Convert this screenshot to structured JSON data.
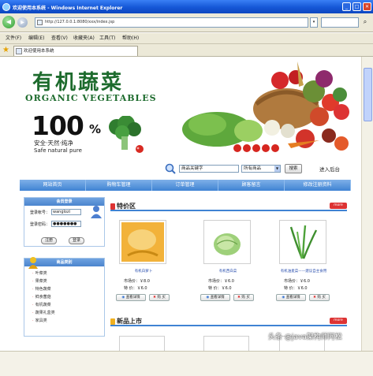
{
  "browser": {
    "title": "欢迎使用本系统 - Windows Internet Explorer",
    "address": "http://127.0.0.1:8080/xxx/index.jsp",
    "menus": [
      "文件(F)",
      "编辑(E)",
      "查看(V)",
      "收藏夹(A)",
      "工具(T)",
      "帮助(H)"
    ],
    "tab": "欢迎使用本系统"
  },
  "banner": {
    "logo_cn": "有机蔬菜",
    "logo_en": "ORGANIC VEGETABLES",
    "badge_num": "100",
    "badge_pct": "%",
    "slogan_cn": "安全·天然·纯净",
    "slogan_en": "Safe natural pure"
  },
  "search": {
    "keyword": "商品关键字",
    "category": "所有商品",
    "button": "搜索",
    "admin": "进入后台"
  },
  "nav": [
    "网站首页",
    "购物车管理",
    "订单管理",
    "顾客留言",
    "修改注册资料"
  ],
  "login": {
    "title": "会员登录",
    "user_label": "登录帐号：",
    "user_value": "wanglozi",
    "pass_label": "登录密码：",
    "pass_value": "●●●●●●●",
    "register": "注册",
    "submit": "登录"
  },
  "categories": {
    "title": "商品类别",
    "items": [
      "叶菜类",
      "果菜类",
      "特色蔬菜",
      "鲜食菌菇",
      "有机蔬菜",
      "蔬果礼盒类",
      "家具类"
    ]
  },
  "specials": {
    "title": "特价区",
    "more": "more",
    "products": [
      {
        "name": "有机白萝卜",
        "market": "市场价：￥8.0",
        "member": "特  价：￥6.0"
      },
      {
        "name": "有机西白菜",
        "market": "市场价：￥6.0",
        "member": "特  价：￥6.0"
      },
      {
        "name": "有机油麦菜——建议自主食用",
        "market": "市场价：￥6.0",
        "member": "特  价：￥6.0"
      }
    ],
    "btn_detail": "查看详情",
    "btn_buy": "购 买"
  },
  "new_arrivals": {
    "title": "新品上市",
    "more": "more"
  },
  "watermark": "头条 @java架构师阿松",
  "colors": {
    "nav_blue": "#3f83d3",
    "brand_green": "#1d6b2d",
    "accent_red": "#d33"
  }
}
